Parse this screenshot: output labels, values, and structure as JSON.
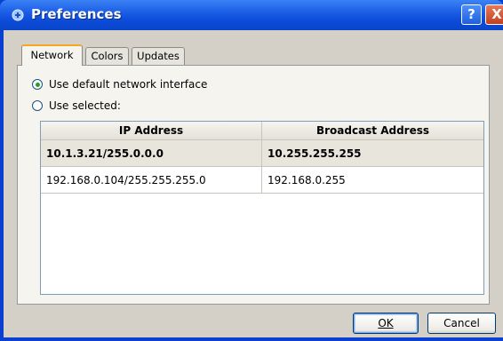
{
  "window": {
    "title": "Preferences",
    "help_label": "?",
    "close_label": "X"
  },
  "tabs": [
    {
      "label": "Network",
      "active": true
    },
    {
      "label": "Colors",
      "active": false
    },
    {
      "label": "Updates",
      "active": false
    }
  ],
  "network": {
    "option_default": {
      "label": "Use default network interface",
      "checked": true
    },
    "option_selected": {
      "label": "Use selected:",
      "checked": false
    }
  },
  "table": {
    "columns": [
      "IP Address",
      "Broadcast Address"
    ],
    "rows": [
      {
        "ip": "10.1.3.21/255.0.0.0",
        "broadcast": "10.255.255.255",
        "selected": true
      },
      {
        "ip": "192.168.0.104/255.255.255.0",
        "broadcast": "192.168.0.255",
        "selected": false
      }
    ]
  },
  "buttons": {
    "ok": "OK",
    "cancel": "Cancel"
  },
  "colors": {
    "titlebar": "#0b4bd8",
    "dialog_bg": "#d4d0c8",
    "tab_accent": "#f5a623",
    "radio_dot": "#21a121"
  }
}
